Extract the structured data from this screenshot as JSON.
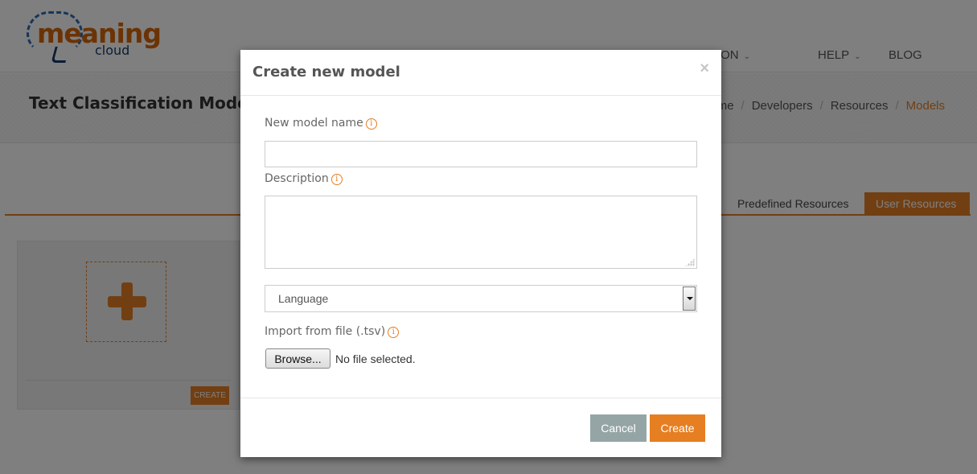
{
  "brand": {
    "logo_main": "meaning",
    "logo_sub": "cloud",
    "accent_color": "#e57e25"
  },
  "nav": {
    "items": [
      {
        "label": "DOCUMENTATION",
        "visible_label": "ENTATION",
        "has_dropdown": true
      },
      {
        "label": "HELP",
        "has_dropdown": true
      },
      {
        "label": "BLOG",
        "has_dropdown": false
      }
    ],
    "chevron_glyph": "⌄"
  },
  "page": {
    "title": "Text Classification Models",
    "breadcrumb": [
      {
        "label": "me",
        "active": false
      },
      {
        "label": "Developers",
        "active": false
      },
      {
        "label": "Resources",
        "active": false
      },
      {
        "label": "Models",
        "active": true
      }
    ],
    "breadcrumb_separator": "/",
    "tabs": [
      {
        "label": "Predefined Resources",
        "active": false
      },
      {
        "label": "User Resources",
        "active": true
      }
    ],
    "card": {
      "create_label": "CREATE"
    }
  },
  "modal": {
    "title": "Create new model",
    "close_glyph": "×",
    "fields": {
      "name_label": "New model name",
      "name_value": "",
      "description_label": "Description",
      "description_value": "",
      "language_selected": "Language",
      "import_label": "Import from file (.tsv)",
      "browse_label": "Browse...",
      "file_status": "No file selected."
    },
    "info_glyph": "i",
    "buttons": {
      "cancel": "Cancel",
      "create": "Create"
    },
    "colors": {
      "cancel_bg": "#95a5a6",
      "create_bg": "#e67e22"
    }
  }
}
